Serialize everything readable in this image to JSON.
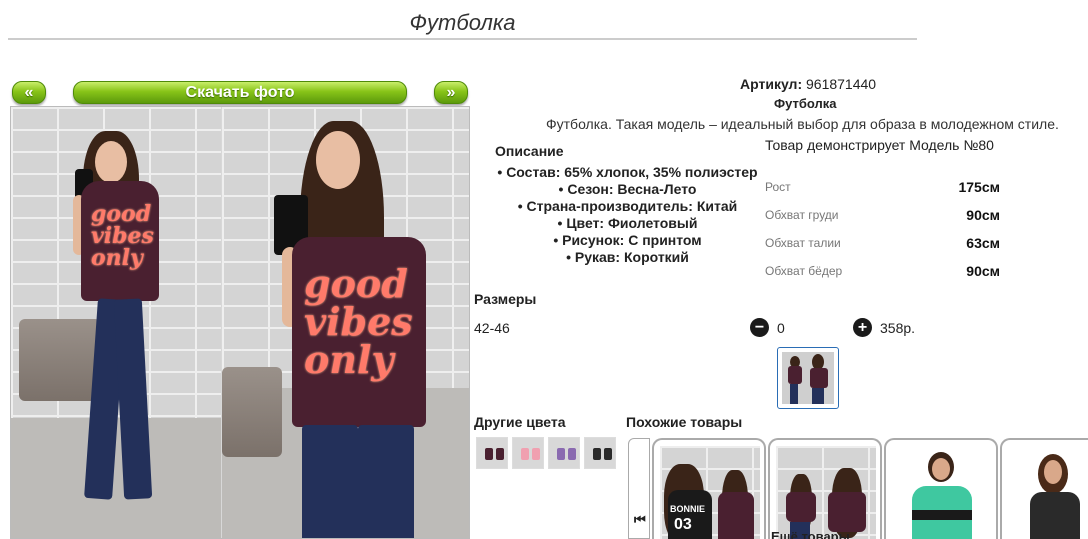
{
  "page": {
    "title": "Футболка"
  },
  "gallery": {
    "prev_label": "«",
    "download_label": "Скачать фото",
    "next_label": "»",
    "print_text_left": [
      "good",
      "vibes",
      "only"
    ],
    "print_text_right": [
      "good",
      "vibes",
      "only"
    ]
  },
  "product": {
    "article_label": "Артикул:",
    "article_value": "961871440",
    "name": "Футболка",
    "description": "Футболка. Такая модель – идеальный выбор для образа в молодежном стиле.",
    "model_line": "Товар демонстрирует Модель №80"
  },
  "details": {
    "heading": "Описание",
    "items": [
      "Состав: 65% хлопок, 35% полиэстер",
      "Сезон: Весна-Лето",
      "Страна-производитель: Китай",
      "Цвет: Фиолетовый",
      "Рисунок: С принтом",
      "Рукав: Короткий"
    ]
  },
  "measurements": [
    {
      "label": "Рост",
      "value": "175см"
    },
    {
      "label": "Обхват груди",
      "value": "90см"
    },
    {
      "label": "Обхват талии",
      "value": "63см"
    },
    {
      "label": "Обхват бёдер",
      "value": "90см"
    }
  ],
  "sizes": {
    "heading": "Размеры",
    "size": "42-46",
    "minus_label": "−",
    "quantity": "0",
    "plus_label": "+",
    "price": "358р."
  },
  "other_colors": {
    "heading": "Другие цвета",
    "swatches": [
      "#4a2030",
      "#f0a0b0",
      "#8a6ab0",
      "#2a2a2a"
    ]
  },
  "similar": {
    "heading": "Похожие товары",
    "first_label": "⏮",
    "more_label": "Ещё товары",
    "items_print": [
      "BONNIE",
      "03"
    ]
  },
  "colors": {
    "accent_green": "#88c418",
    "selected_border": "#2a6db5",
    "shirt": "#4a2030"
  }
}
